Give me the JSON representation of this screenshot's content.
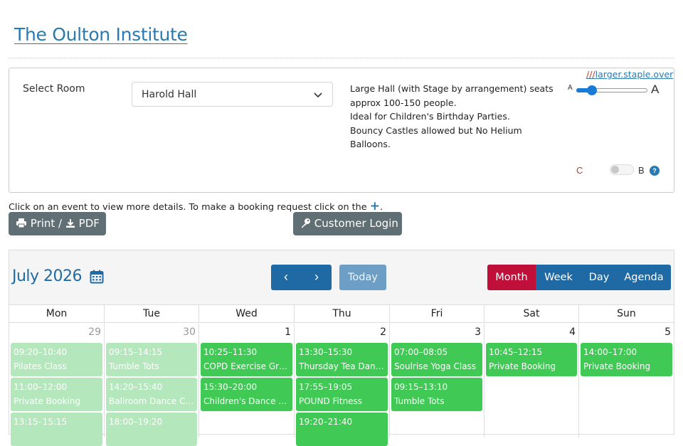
{
  "site": {
    "title": "The Oulton Institute"
  },
  "room_panel": {
    "select_label": "Select Room",
    "selected_room": "Harold Hall",
    "description_lines": [
      "Large Hall (with Stage by arrangement) seats",
      "approx 100-150 people.",
      "Ideal for Children's Birthday Parties.",
      "Bouncy Castles allowed but No Helium",
      "Balloons."
    ],
    "link_slashes": "///",
    "link_text": "larger.staple.over",
    "font_small_label": "A",
    "font_large_label": "A",
    "font_size_level": 0.15,
    "toggle_left_label": "C",
    "toggle_right_label": "B",
    "help_label": "?"
  },
  "instructions": {
    "text": "Click on an event to view more details. To make a booking request click on the",
    "plus": "+",
    "end": "."
  },
  "buttons": {
    "print": "Print /",
    "pdf": "PDF",
    "login": "Customer Login"
  },
  "calendar": {
    "month_title": "July 2026",
    "prev": "‹",
    "next": "›",
    "today": "Today",
    "views": [
      "Month",
      "Week",
      "Day",
      "Agenda"
    ],
    "active_view": "Month",
    "weekdays": [
      "Mon",
      "Tue",
      "Wed",
      "Thu",
      "Fri",
      "Sat",
      "Sun"
    ],
    "days": [
      {
        "num": "29",
        "other": true,
        "events": [
          {
            "time": "09:20–10:40",
            "title": "Pilates Class"
          },
          {
            "time": "11:00–12:00",
            "title": "Private Booking"
          },
          {
            "time": "13:15–15:15",
            "title": ""
          }
        ]
      },
      {
        "num": "30",
        "other": true,
        "events": [
          {
            "time": "09:15–14:15",
            "title": "Tumble Tots"
          },
          {
            "time": "14:20–15:40",
            "title": "Ballroom Dance Cla…"
          },
          {
            "time": "18:00–19:20",
            "title": ""
          }
        ]
      },
      {
        "num": "1",
        "other": false,
        "events": [
          {
            "time": "10:25–11:30",
            "title": "COPD Exercise Group"
          },
          {
            "time": "15:30–20:00",
            "title": "Children's Dance Cl…"
          }
        ]
      },
      {
        "num": "2",
        "other": false,
        "events": [
          {
            "time": "13:30–15:30",
            "title": "Thursday Tea Dance"
          },
          {
            "time": "17:55–19:05",
            "title": "POUND Fitness"
          },
          {
            "time": "19:20–21:40",
            "title": ""
          }
        ]
      },
      {
        "num": "3",
        "other": false,
        "events": [
          {
            "time": "07:00–08:05",
            "title": "Soulrise Yoga Class"
          },
          {
            "time": "09:15–13:10",
            "title": "Tumble Tots"
          }
        ]
      },
      {
        "num": "4",
        "other": false,
        "events": [
          {
            "time": "10:45–12:15",
            "title": "Private Booking"
          }
        ]
      },
      {
        "num": "5",
        "other": false,
        "events": [
          {
            "time": "14:00–17:00",
            "title": "Private Booking"
          }
        ]
      }
    ]
  }
}
